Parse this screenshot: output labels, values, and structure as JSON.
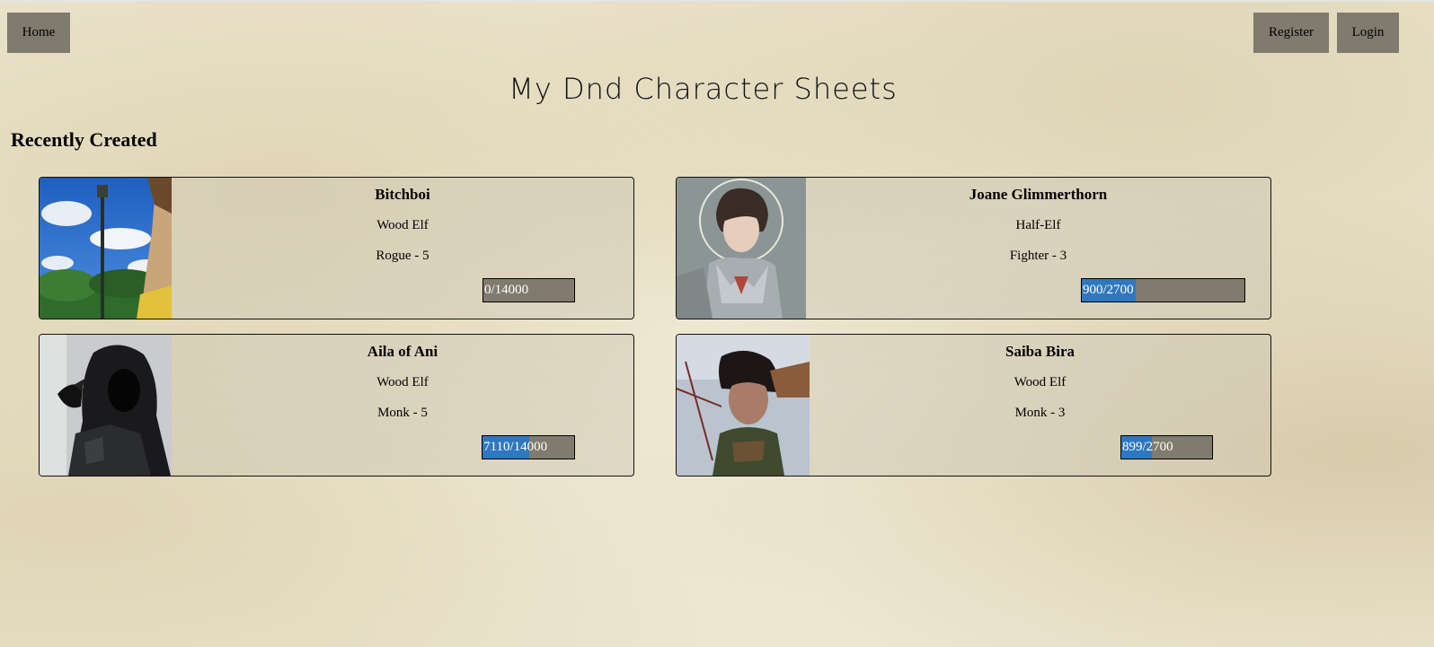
{
  "nav": {
    "home_label": "Home",
    "register_label": "Register",
    "login_label": "Login"
  },
  "page": {
    "title": "My Dnd Character Sheets",
    "section_heading": "Recently Created"
  },
  "colors": {
    "nav_button_bg": "#7f7b6e",
    "xp_fill": "#2f78bf",
    "xp_track": "#7f7b6e"
  },
  "characters": [
    {
      "name": "Bitchboi",
      "race": "Wood Elf",
      "class_level": "Rogue - 5",
      "xp_text": "0/14000",
      "xp_current": 0,
      "xp_max": 14000,
      "portrait": "character-portrait-sky-lamppost"
    },
    {
      "name": "Joane Glimmerthorn",
      "race": "Half-Elf",
      "class_level": "Fighter - 3",
      "xp_text": "900/2700",
      "xp_current": 900,
      "xp_max": 2700,
      "portrait": "character-portrait-armored-woman"
    },
    {
      "name": "Aila of Ani",
      "race": "Wood Elf",
      "class_level": "Monk - 5",
      "xp_text": "7110/14000",
      "xp_current": 7110,
      "xp_max": 14000,
      "portrait": "character-portrait-hooded-figure-raven"
    },
    {
      "name": "Saiba Bira",
      "race": "Wood Elf",
      "class_level": "Monk - 3",
      "xp_text": "899/2700",
      "xp_current": 899,
      "xp_max": 2700,
      "portrait": "character-portrait-elf-archer"
    }
  ]
}
